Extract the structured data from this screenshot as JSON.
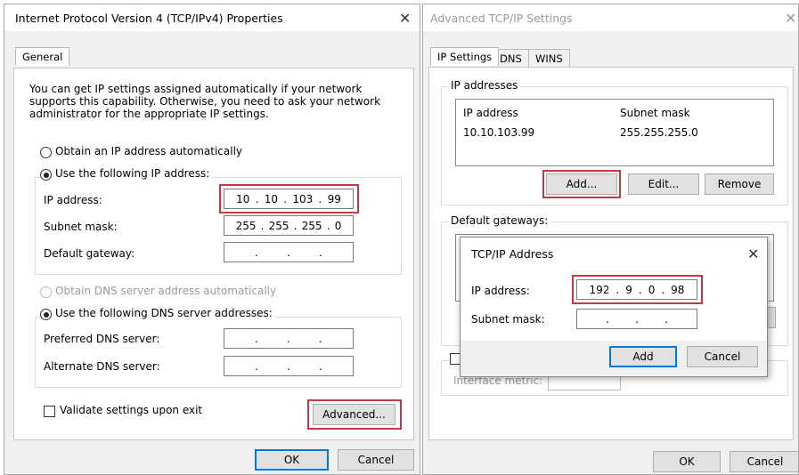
{
  "left_dialog": {
    "title": "Internet Protocol Version 4 (TCP/IPv4) Properties",
    "close_glyph": "✕",
    "tab_general": "General",
    "description": "You can get IP settings assigned automatically if your network supports this capability. Otherwise, you need to ask your network administrator for the appropriate IP settings.",
    "radio_auto_ip": "Obtain an IP address automatically",
    "radio_manual_ip": "Use the following IP address:",
    "ip_label": "IP address:",
    "ip_value": [
      "10",
      "10",
      "103",
      "99"
    ],
    "mask_label": "Subnet mask:",
    "mask_value": [
      "255",
      "255",
      "255",
      "0"
    ],
    "gateway_label": "Default gateway:",
    "radio_auto_dns": "Obtain DNS server address automatically",
    "radio_manual_dns": "Use the following DNS server addresses:",
    "preferred_dns_label": "Preferred DNS server:",
    "alternate_dns_label": "Alternate DNS server:",
    "validate_label": "Validate settings upon exit",
    "advanced_button": "Advanced...",
    "ok_button": "OK",
    "cancel_button": "Cancel"
  },
  "right_dialog": {
    "title": "Advanced TCP/IP Settings",
    "close_glyph": "✕",
    "tabs": [
      "IP Settings",
      "DNS",
      "WINS"
    ],
    "ip_addresses_group": "IP addresses",
    "col_ip": "IP address",
    "col_mask": "Subnet mask",
    "row_ip": "10.10.103.99",
    "row_mask": "255.255.255.0",
    "add_button": "Add...",
    "edit_button": "Edit...",
    "remove_button": "Remove",
    "gateways_group": "Default gateways:",
    "interface_metric_label": "Interface metric:",
    "ok_button": "OK",
    "cancel_button": "Cancel"
  },
  "popup": {
    "title": "TCP/IP Address",
    "close_glyph": "✕",
    "ip_label": "IP address:",
    "ip_value": [
      "192",
      "9",
      "0",
      "98"
    ],
    "mask_label": "Subnet mask:",
    "add_button": "Add",
    "cancel_button": "Cancel"
  },
  "colors": {
    "highlight": "#c8373f",
    "default_button_border": "#0078d7"
  }
}
